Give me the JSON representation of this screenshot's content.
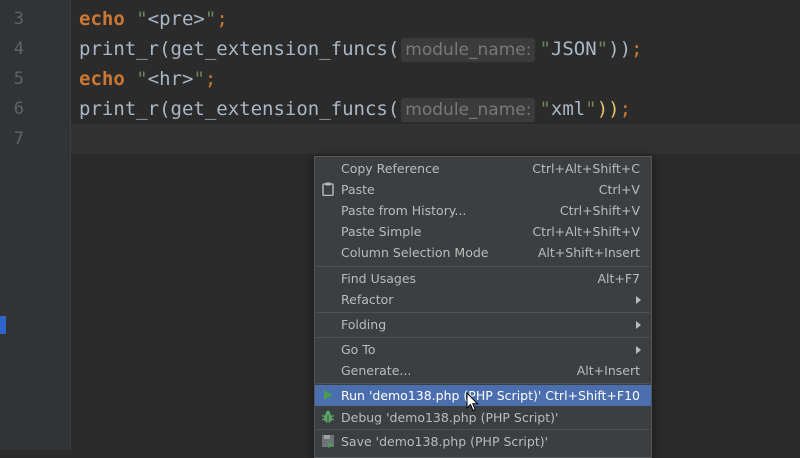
{
  "gutter": {
    "line_numbers": [
      "3",
      "4",
      "5",
      "6",
      "7"
    ]
  },
  "code": {
    "line3": {
      "kw": "echo",
      "q1": "\"",
      "str": "<pre>",
      "q2": "\"",
      "semi": ";"
    },
    "line4": {
      "fn": "print_r(get_extension_funcs(",
      "hint": "module_name:",
      "q1": "\"",
      "str": "JSON",
      "q2": "\"",
      "close": "))",
      "semi": ";"
    },
    "line5": {
      "kw": "echo",
      "q1": "\"",
      "str": "<hr>",
      "q2": "\"",
      "semi": ";"
    },
    "line6": {
      "fn": "print_r(get_extension_funcs(",
      "hint": "module_name:",
      "q1": "\"",
      "str": "xml",
      "q2": "\"",
      "close": "))",
      "semi": ";"
    }
  },
  "menu": {
    "items": [
      {
        "label": "Copy Reference",
        "shortcut": "Ctrl+Alt+Shift+C"
      },
      {
        "label": "Paste",
        "shortcut": "Ctrl+V",
        "icon": "clipboard-icon"
      },
      {
        "label": "Paste from History...",
        "shortcut": "Ctrl+Shift+V"
      },
      {
        "label": "Paste Simple",
        "shortcut": "Ctrl+Alt+Shift+V"
      },
      {
        "label": "Column Selection Mode",
        "shortcut": "Alt+Shift+Insert"
      },
      {
        "label": "Find Usages",
        "shortcut": "Alt+F7"
      },
      {
        "label": "Refactor",
        "submenu": true
      },
      {
        "label": "Folding",
        "submenu": true
      },
      {
        "label": "Go To",
        "submenu": true
      },
      {
        "label": "Generate...",
        "shortcut": "Alt+Insert"
      },
      {
        "label": "Run 'demo138.php (PHP Script)'",
        "shortcut": "Ctrl+Shift+F10",
        "icon": "run-icon",
        "selected": true
      },
      {
        "label": "Debug 'demo138.php (PHP Script)'",
        "icon": "debug-icon"
      },
      {
        "label": "Save 'demo138.php (PHP Script)'",
        "icon": "save-config-icon"
      }
    ]
  },
  "colors": {
    "background": "#2b2b2b",
    "keyword": "#cc7832",
    "string": "#6a8759",
    "menu_bg": "#3c3f41",
    "menu_selected": "#4b6eaf",
    "run_icon": "#499c54",
    "debug_icon": "#59a869"
  }
}
